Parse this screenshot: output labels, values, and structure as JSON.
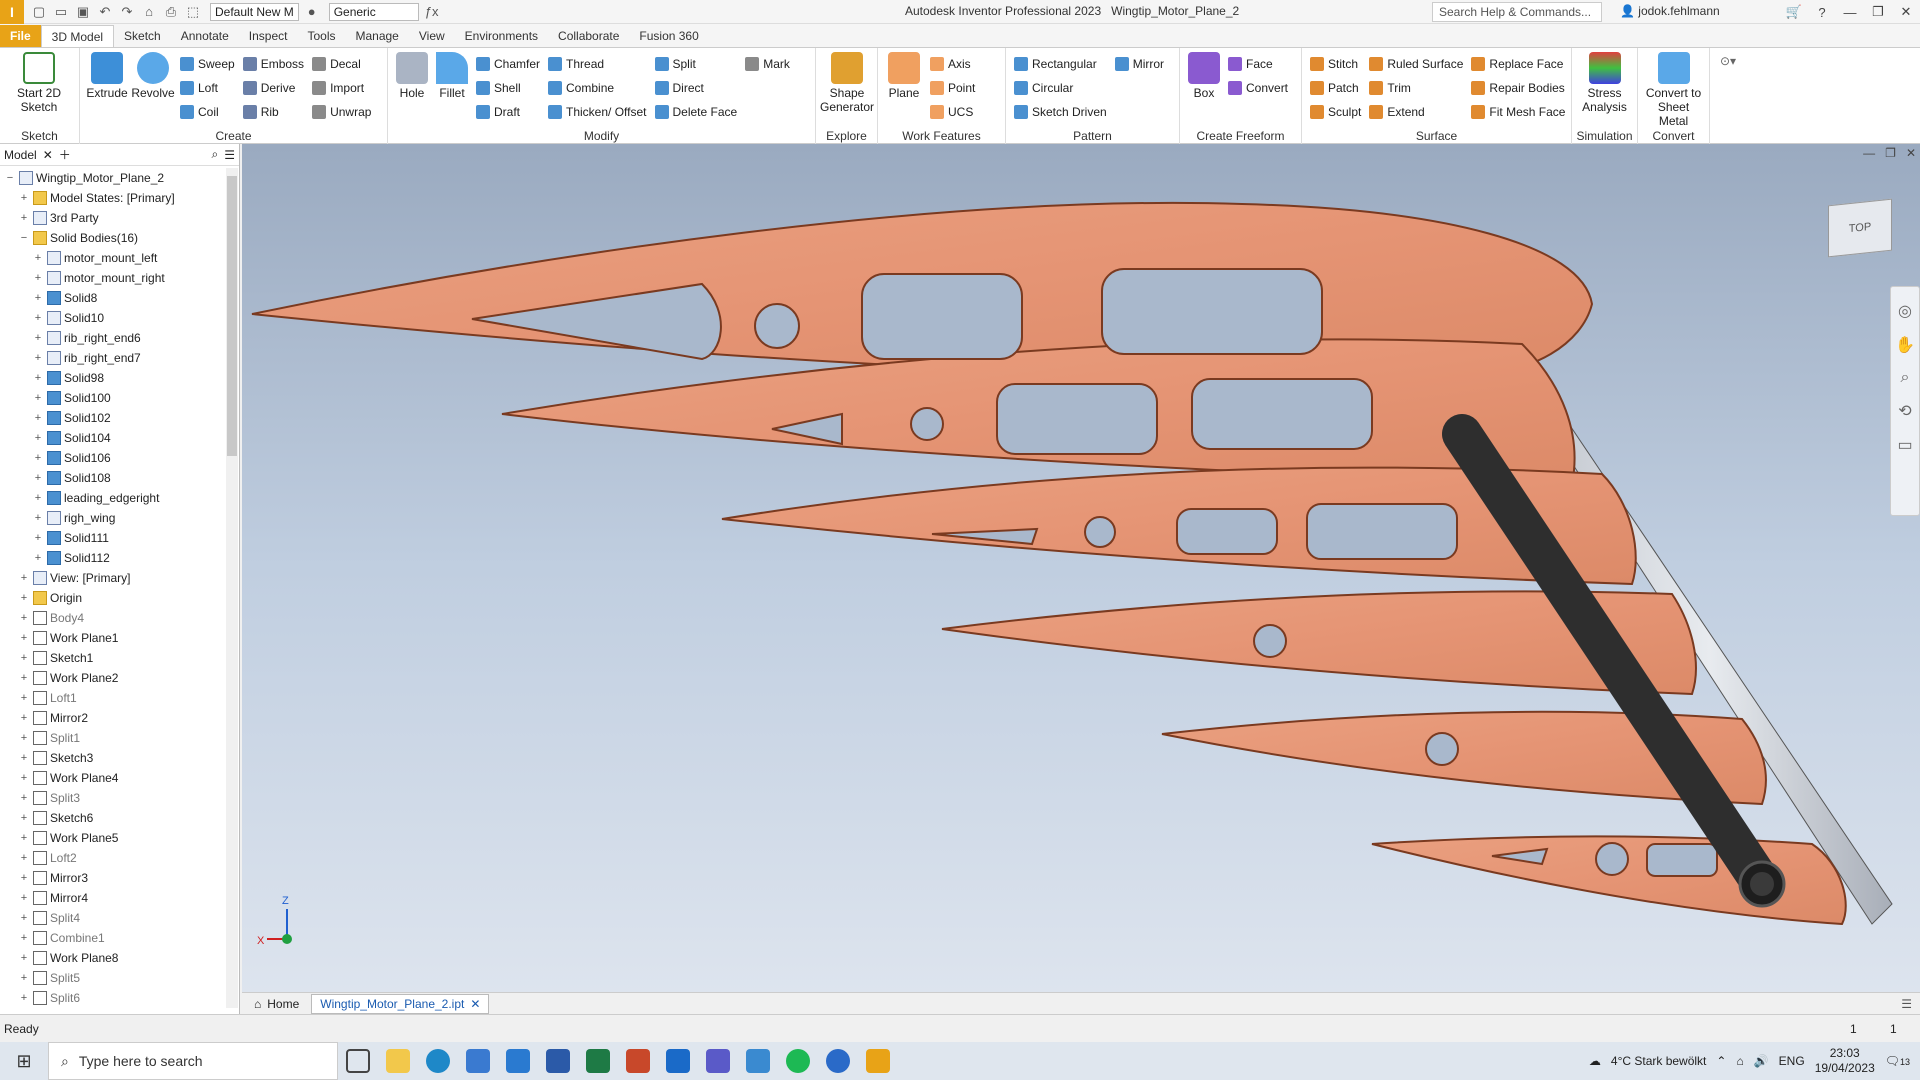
{
  "app": {
    "logo": "I",
    "title": "Autodesk Inventor Professional 2023",
    "document": "Wingtip_Motor_Plane_2"
  },
  "qat": {
    "style_combo": "Default New M",
    "material_combo": "Generic"
  },
  "search": {
    "placeholder": "Search Help & Commands..."
  },
  "user": {
    "name": "jodok.fehlmann"
  },
  "tabs": [
    "File",
    "3D Model",
    "Sketch",
    "Annotate",
    "Inspect",
    "Tools",
    "Manage",
    "View",
    "Environments",
    "Collaborate",
    "Fusion 360"
  ],
  "ribbon": {
    "sketch": {
      "label": "Sketch",
      "start": "Start 2D Sketch"
    },
    "create": {
      "label": "Create",
      "extrude": "Extrude",
      "revolve": "Revolve",
      "items": [
        "Sweep",
        "Loft",
        "Coil",
        "Emboss",
        "Derive",
        "Rib",
        "Decal",
        "Import",
        "Unwrap"
      ]
    },
    "modify": {
      "label": "Modify",
      "hole": "Hole",
      "fillet": "Fillet",
      "items": [
        "Chamfer",
        "Shell",
        "Draft",
        "Thread",
        "Combine",
        "Thicken/ Offset",
        "Split",
        "Direct",
        "Delete Face",
        "Mark"
      ]
    },
    "explore": {
      "label": "Explore",
      "shape": "Shape Generator"
    },
    "work": {
      "label": "Work Features",
      "plane": "Plane",
      "items": [
        "Axis",
        "Point",
        "UCS"
      ]
    },
    "pattern": {
      "label": "Pattern",
      "items": [
        "Rectangular",
        "Circular",
        "Sketch Driven",
        "Mirror"
      ]
    },
    "freeform": {
      "label": "Create Freeform",
      "box": "Box",
      "items": [
        "Face",
        "Convert"
      ]
    },
    "surface": {
      "label": "Surface",
      "items": [
        "Stitch",
        "Patch",
        "Sculpt",
        "Ruled Surface",
        "Trim",
        "Extend",
        "Replace Face",
        "Repair Bodies",
        "Fit Mesh Face"
      ]
    },
    "simulation": {
      "label": "Simulation",
      "stress": "Stress Analysis"
    },
    "convert": {
      "label": "Convert",
      "sheet": "Convert to Sheet Metal"
    }
  },
  "browser": {
    "tab": "Model",
    "nodes": [
      {
        "label": "Wingtip_Motor_Plane_2",
        "indent": 0,
        "icon": "part"
      },
      {
        "label": "Model States: [Primary]",
        "indent": 1,
        "icon": "folder"
      },
      {
        "label": "3rd Party",
        "indent": 1,
        "icon": "part"
      },
      {
        "label": "Solid Bodies(16)",
        "indent": 1,
        "icon": "folder"
      },
      {
        "label": "motor_mount_left",
        "indent": 2,
        "icon": "part"
      },
      {
        "label": "motor_mount_right",
        "indent": 2,
        "icon": "part"
      },
      {
        "label": "Solid8",
        "indent": 2,
        "icon": "solid"
      },
      {
        "label": "Solid10",
        "indent": 2,
        "icon": "part"
      },
      {
        "label": "rib_right_end6",
        "indent": 2,
        "icon": "part"
      },
      {
        "label": "rib_right_end7",
        "indent": 2,
        "icon": "part"
      },
      {
        "label": "Solid98",
        "indent": 2,
        "icon": "solid"
      },
      {
        "label": "Solid100",
        "indent": 2,
        "icon": "solid"
      },
      {
        "label": "Solid102",
        "indent": 2,
        "icon": "solid"
      },
      {
        "label": "Solid104",
        "indent": 2,
        "icon": "solid"
      },
      {
        "label": "Solid106",
        "indent": 2,
        "icon": "solid"
      },
      {
        "label": "Solid108",
        "indent": 2,
        "icon": "solid"
      },
      {
        "label": "leading_edgeright",
        "indent": 2,
        "icon": "solid"
      },
      {
        "label": "righ_wing",
        "indent": 2,
        "icon": "part"
      },
      {
        "label": "Solid111",
        "indent": 2,
        "icon": "solid"
      },
      {
        "label": "Solid112",
        "indent": 2,
        "icon": "solid"
      },
      {
        "label": "View: [Primary]",
        "indent": 1,
        "icon": "part"
      },
      {
        "label": "Origin",
        "indent": 1,
        "icon": "folder"
      },
      {
        "label": "Body4",
        "indent": 1,
        "icon": "feature",
        "faded": true
      },
      {
        "label": "Work Plane1",
        "indent": 1,
        "icon": "feature"
      },
      {
        "label": "Sketch1",
        "indent": 1,
        "icon": "feature"
      },
      {
        "label": "Work Plane2",
        "indent": 1,
        "icon": "feature"
      },
      {
        "label": "Loft1",
        "indent": 1,
        "icon": "feature",
        "faded": true
      },
      {
        "label": "Mirror2",
        "indent": 1,
        "icon": "feature"
      },
      {
        "label": "Split1",
        "indent": 1,
        "icon": "feature",
        "faded": true
      },
      {
        "label": "Sketch3",
        "indent": 1,
        "icon": "feature"
      },
      {
        "label": "Work Plane4",
        "indent": 1,
        "icon": "feature"
      },
      {
        "label": "Split3",
        "indent": 1,
        "icon": "feature",
        "faded": true
      },
      {
        "label": "Sketch6",
        "indent": 1,
        "icon": "feature"
      },
      {
        "label": "Work Plane5",
        "indent": 1,
        "icon": "feature"
      },
      {
        "label": "Loft2",
        "indent": 1,
        "icon": "feature",
        "faded": true
      },
      {
        "label": "Mirror3",
        "indent": 1,
        "icon": "feature"
      },
      {
        "label": "Mirror4",
        "indent": 1,
        "icon": "feature"
      },
      {
        "label": "Split4",
        "indent": 1,
        "icon": "feature",
        "faded": true
      },
      {
        "label": "Combine1",
        "indent": 1,
        "icon": "feature",
        "faded": true
      },
      {
        "label": "Work Plane8",
        "indent": 1,
        "icon": "feature"
      },
      {
        "label": "Split5",
        "indent": 1,
        "icon": "feature",
        "faded": true
      },
      {
        "label": "Split6",
        "indent": 1,
        "icon": "feature",
        "faded": true
      }
    ]
  },
  "viewcube": {
    "label": "TOP"
  },
  "axes": {
    "x": "X",
    "z": "Z"
  },
  "doctabs": {
    "home": "Home",
    "active": "Wingtip_Motor_Plane_2.ipt"
  },
  "status": {
    "text": "Ready",
    "count1": "1",
    "count2": "1"
  },
  "taskbar": {
    "search": "Type here to search",
    "weather": "4°C  Stark bewölkt",
    "lang": "ENG",
    "time": "23:03",
    "date": "19/04/2023",
    "notif": "13"
  }
}
